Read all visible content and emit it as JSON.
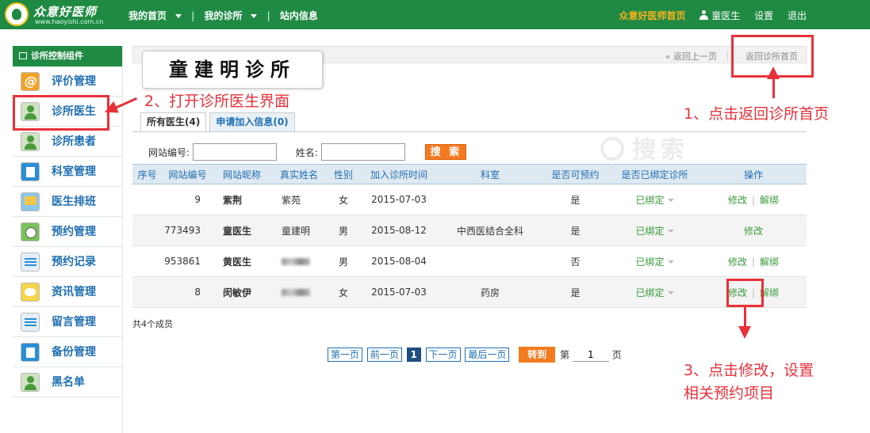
{
  "header": {
    "logo_text": "众意好医师",
    "logo_url_text": "www.haoyishi.com.cn",
    "nav": {
      "my_home": "我的首页",
      "my_clinic": "我的诊所",
      "messages": "站内信息",
      "separator": "|"
    },
    "site_home": "众意好医师首页",
    "user_name": "童医生",
    "settings": "设置",
    "logout": "退出"
  },
  "sidebar": {
    "title": "诊所控制组件",
    "items": [
      {
        "label": "评价管理",
        "icon": "at-icon"
      },
      {
        "label": "诊所医生",
        "icon": "doctor-icon"
      },
      {
        "label": "诊所患者",
        "icon": "patient-icon"
      },
      {
        "label": "科室管理",
        "icon": "clipboard-icon"
      },
      {
        "label": "医生排班",
        "icon": "board-icon"
      },
      {
        "label": "预约管理",
        "icon": "clock-icon"
      },
      {
        "label": "预约记录",
        "icon": "note-icon"
      },
      {
        "label": "资讯管理",
        "icon": "chat-icon"
      },
      {
        "label": "留言管理",
        "icon": "note-icon"
      },
      {
        "label": "备份管理",
        "icon": "clipboard-icon"
      },
      {
        "label": "黑名单",
        "icon": "person-icon"
      }
    ]
  },
  "breadcrumb": {
    "back": "« 返回上一页",
    "separator": "|",
    "clinic_home": "返回诊所首页"
  },
  "clinic_name": "童建明诊所",
  "tabs": [
    {
      "label": "所有医生(4)",
      "active": true
    },
    {
      "label": "申请加入信息(0)",
      "active": false
    }
  ],
  "search": {
    "site_id_label": "网站编号:",
    "site_id_value": "",
    "name_label": "姓名:",
    "name_value": "",
    "button": "搜 索",
    "watermark": "搜索"
  },
  "table": {
    "headers": [
      "序号",
      "网站编号",
      "网站昵称",
      "真实姓名",
      "性别",
      "加入诊所时间",
      "科室",
      "是否可预约",
      "是否已绑定诊所",
      "操作"
    ],
    "rows": [
      {
        "index": "",
        "site_id": "9",
        "nickname": "紫荆",
        "real_name": "紫苑",
        "gender": "女",
        "joined": "2015-07-03",
        "department": "",
        "bookable": "是",
        "bound": "已绑定",
        "edit": "修改",
        "unbind": "解绑"
      },
      {
        "index": "",
        "site_id": "773493",
        "nickname": "童医生",
        "real_name": "童建明",
        "gender": "男",
        "joined": "2015-08-12",
        "department": "中西医结合全科",
        "bookable": "是",
        "bound": "已绑定",
        "edit": "修改",
        "unbind": ""
      },
      {
        "index": "",
        "site_id": "953861",
        "nickname": "黄医生",
        "real_name": "",
        "gender": "男",
        "joined": "2015-08-04",
        "department": "",
        "bookable": "否",
        "bound": "已绑定",
        "edit": "修改",
        "unbind": "解绑"
      },
      {
        "index": "",
        "site_id": "8",
        "nickname": "闵敏伊",
        "real_name": "",
        "gender": "女",
        "joined": "2015-07-03",
        "department": "药房",
        "bookable": "是",
        "bound": "已绑定",
        "edit": "修改",
        "unbind": "解绑"
      }
    ],
    "op_separator": "|"
  },
  "member_count": "共4个成员",
  "pager": {
    "first": "第一页",
    "prev": "前一页",
    "current": "1",
    "next": "下一页",
    "last": "最后一页",
    "goto": "转到",
    "page_prefix": "第",
    "page_input": "1",
    "page_suffix": "页"
  },
  "annotations": {
    "step1": "1、点击返回诊所首页",
    "step2": "2、打开诊所医生界面",
    "step3_line1": "3、点击修改，设置",
    "step3_line2": "相关预约项目"
  },
  "colors": {
    "brand_green": "#1f8a43",
    "link_blue": "#1f6fb2",
    "accent_orange": "#f47a1f",
    "annotation_red": "#e8313a"
  }
}
